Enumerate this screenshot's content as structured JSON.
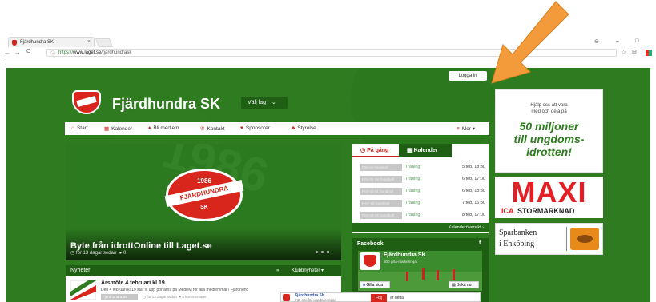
{
  "browser": {
    "tab_title": "Fjärdhundra SK",
    "tab_close": "×",
    "url_scheme": "https://",
    "url_host": "www.laget.se",
    "url_path": "/fjardhundrask",
    "back": "←",
    "forward": "→",
    "reload": "C",
    "win_user": "⊖",
    "win_min": "–",
    "win_max": "□",
    "star": "☆",
    "reader": "⊟",
    "menu_dots": "⋮"
  },
  "header": {
    "login": "Logga in",
    "club_name": "Fjärdhundra SK",
    "choose_team": "Välj lag"
  },
  "nav": {
    "start": "Start",
    "calendar": "Kalender",
    "member": "Bli medlem",
    "contact": "Kontakt",
    "sponsors": "Sponsorer",
    "board": "Styrelse",
    "more": "Mer"
  },
  "hero": {
    "title": "Byte från idrottOnline till Laget.se",
    "meta_time": "för 13 dagar sedan",
    "meta_comments": "0",
    "crest_year": "1986",
    "crest_name": "FJÄRDHUNDRA",
    "crest_sk": "SK",
    "bg_text": "1986"
  },
  "events": {
    "tab_ongoing": "På gång",
    "tab_calendar": "Kalender",
    "overview": "Kalenderöversikt ›",
    "rows": [
      {
        "team": "F06-06 handboll",
        "activity": "Träning",
        "date": "5 feb, 18:30"
      },
      {
        "team": "P04-05 SK handboll",
        "activity": "Träning",
        "date": "6 feb, 17:00"
      },
      {
        "team": "P03-02-01 handboll",
        "activity": "Träning",
        "date": "6 feb, 18:30"
      },
      {
        "team": "F-07-08 handboll",
        "activity": "Träning",
        "date": "7 feb, 16:30"
      },
      {
        "team": "P04-05 SK handboll",
        "activity": "Träning",
        "date": "8 feb, 17:00"
      }
    ]
  },
  "facebook": {
    "header": "Facebook",
    "page_name": "Fjärdhundra SK",
    "likes": "500 gilla-markeringar",
    "like_btn": "Gilla sida",
    "book_btn": "Boka nu",
    "widget_name": "Fjärdhundra SK",
    "widget_text": "Följ oss för uppdateringar",
    "follow": "Följ",
    "follow_text": "ar detta"
  },
  "news": {
    "header": "Nyheter",
    "rss": "»",
    "club_news": "Klubbnyheter",
    "title": "Årsmöte 4 februari kl 19",
    "excerpt": "Den 4 februari kl 19 står vi upp portarna på Medievi för alla medlemmar i Fjärdhund",
    "tag": "Fjärdhundra SK",
    "time": "för 13 dagar sedan",
    "comments": "0 kommentarer"
  },
  "ads": {
    "ad1_line1": "Hjälp oss att vara",
    "ad1_line2": "med och dela på",
    "ad1_big1": "50 miljoner",
    "ad1_big2": "till ungdoms-",
    "ad1_big3": "idrotten!",
    "ad2_big": "MAXI",
    "ad2_ica": "ICA",
    "ad2_small": "STORMARKNAD",
    "ad3_line1": "Sparbanken",
    "ad3_line2": "i Enköping"
  },
  "colors": {
    "site_green": "#2e7c1f",
    "dark_green": "#1e5f13",
    "red": "#d8261c",
    "arrow": "#f39a3a"
  }
}
